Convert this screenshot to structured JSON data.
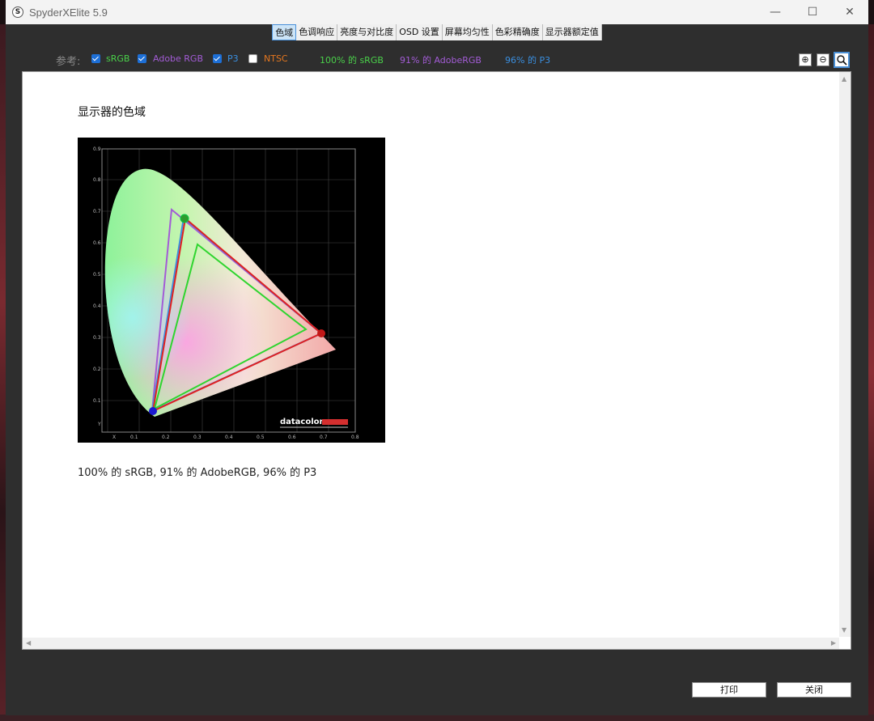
{
  "window": {
    "title": "SpyderXElite 5.9",
    "icon_letter": "S"
  },
  "controls": {
    "minimize": "—",
    "maximize": "☐",
    "close": "✕"
  },
  "tabs": [
    {
      "label": "色域",
      "active": true
    },
    {
      "label": "色调响应",
      "active": false
    },
    {
      "label": "亮度与对比度",
      "active": false
    },
    {
      "label": "OSD 设置",
      "active": false
    },
    {
      "label": "屏幕均匀性",
      "active": false
    },
    {
      "label": "色彩精确度",
      "active": false
    },
    {
      "label": "显示器额定值",
      "active": false
    }
  ],
  "reference": {
    "label": "参考:",
    "items": [
      {
        "label": "sRGB",
        "checked": true,
        "color": "#4ad14a"
      },
      {
        "label": "Adobe RGB",
        "checked": true,
        "color": "#a35cd6"
      },
      {
        "label": "P3",
        "checked": true,
        "color": "#3a8fe0"
      },
      {
        "label": "NTSC",
        "checked": false,
        "color": "#e5771f"
      }
    ],
    "coverage": [
      {
        "text": "100% 的 sRGB",
        "color": "#4ad14a"
      },
      {
        "text": "91% 的 AdobeRGB",
        "color": "#a35cd6"
      },
      {
        "text": "96% 的 P3",
        "color": "#3a8fe0"
      }
    ]
  },
  "zoom": {
    "zoom_in": "⊕",
    "zoom_out": "⊖",
    "fit": "🔍"
  },
  "content": {
    "section_title": "显示器的色域",
    "summary": "100% 的 sRGB, 91% 的 AdobeRGB, 96% 的 P3",
    "chart": {
      "x_ticks": [
        "X",
        "0.1",
        "0.2",
        "0.3",
        "0.4",
        "0.5",
        "0.6",
        "0.7",
        "0.8"
      ],
      "y_ticks": [
        "Y",
        "0.1",
        "0.2",
        "0.3",
        "0.4",
        "0.5",
        "0.6",
        "0.7",
        "0.8",
        "0.9"
      ],
      "brand": "datacolor"
    }
  },
  "buttons": {
    "print": "打印",
    "close": "关闭"
  }
}
